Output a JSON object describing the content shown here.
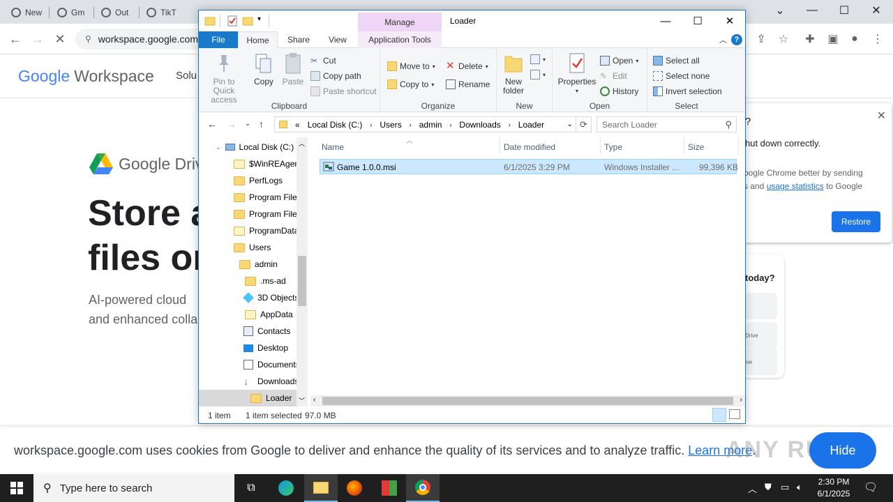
{
  "chrome": {
    "tabs": [
      {
        "label": "New"
      },
      {
        "label": "Gm"
      },
      {
        "label": "Out"
      },
      {
        "label": "TikT"
      }
    ],
    "url": "workspace.google.com/",
    "window_controls": {
      "minimize": "—",
      "maximize": "☐",
      "close": "✕"
    }
  },
  "webpage": {
    "logo": {
      "google": "Google",
      "workspace": "Workspace"
    },
    "nav_partial": "Solu",
    "product": "Google Driv",
    "hero_lines": [
      "Store a",
      "files on"
    ],
    "subtitle_lines": [
      "AI-powered cloud",
      "and enhanced colla"
    ],
    "restore_popup": {
      "question_mark": "?",
      "line1": "hut down correctly.",
      "line2_prefix": "oogle Chrome better by sending",
      "line2b_prefix": "s and ",
      "link": "usage statistics",
      "line2b_suffix": " to Google",
      "button": "Restore"
    },
    "today_card": {
      "title": "today?",
      "opt1": "Drive",
      "opt2": "ive"
    },
    "cookie": {
      "text": "workspace.google.com uses cookies from Google to deliver and enhance the quality of its services and to analyze traffic.",
      "link": "Learn more",
      "link_suffix": ".",
      "hide": "Hide"
    },
    "watermark": "ANY RUN"
  },
  "explorer": {
    "title": "Loader",
    "manage_tab": "Manage",
    "ribbon_tabs": {
      "file": "File",
      "home": "Home",
      "share": "Share",
      "view": "View",
      "app_tools": "Application Tools"
    },
    "ribbon": {
      "clipboard": {
        "label": "Clipboard",
        "pin": "Pin to Quick access",
        "copy": "Copy",
        "paste": "Paste",
        "cut": "Cut",
        "copy_path": "Copy path",
        "paste_shortcut": "Paste shortcut"
      },
      "organize": {
        "label": "Organize",
        "move_to": "Move to",
        "copy_to": "Copy to",
        "delete": "Delete",
        "rename": "Rename"
      },
      "new": {
        "label": "New",
        "new_folder": "New folder"
      },
      "open": {
        "label": "Open",
        "properties": "Properties",
        "open": "Open",
        "edit": "Edit",
        "history": "History"
      },
      "select": {
        "label": "Select",
        "select_all": "Select all",
        "select_none": "Select none",
        "invert": "Invert selection"
      }
    },
    "address": {
      "prefix": "«",
      "crumbs": [
        "Local Disk (C:)",
        "Users",
        "admin",
        "Downloads",
        "Loader"
      ],
      "search_placeholder": "Search Loader"
    },
    "nav_items": [
      {
        "label": "Local Disk (C:)",
        "icon": "drive-icon"
      },
      {
        "label": "$WinREAgent"
      },
      {
        "label": "PerfLogs"
      },
      {
        "label": "Program Files"
      },
      {
        "label": "Program Files"
      },
      {
        "label": "ProgramData"
      },
      {
        "label": "Users"
      },
      {
        "label": "admin"
      },
      {
        "label": ".ms-ad"
      },
      {
        "label": "3D Objects"
      },
      {
        "label": "AppData"
      },
      {
        "label": "Contacts"
      },
      {
        "label": "Desktop"
      },
      {
        "label": "Documents"
      },
      {
        "label": "Downloads"
      },
      {
        "label": "Loader"
      }
    ],
    "columns": {
      "name": "Name",
      "date": "Date modified",
      "type": "Type",
      "size": "Size"
    },
    "files": [
      {
        "name": "Game 1.0.0.msi",
        "date": "6/1/2025 3:29 PM",
        "type": "Windows Installer ...",
        "size": "99,396 KB"
      }
    ],
    "status": {
      "count": "1 item",
      "selected": "1 item selected",
      "size": "97.0 MB"
    }
  },
  "taskbar": {
    "search_placeholder": "Type here to search",
    "time": "2:30 PM",
    "date": "6/1/2025"
  },
  "colors": {
    "accent": "#1979ca",
    "manage_tab": "#f0d6f6",
    "selection": "#cce8ff",
    "chrome_blue": "#1a73e8"
  }
}
